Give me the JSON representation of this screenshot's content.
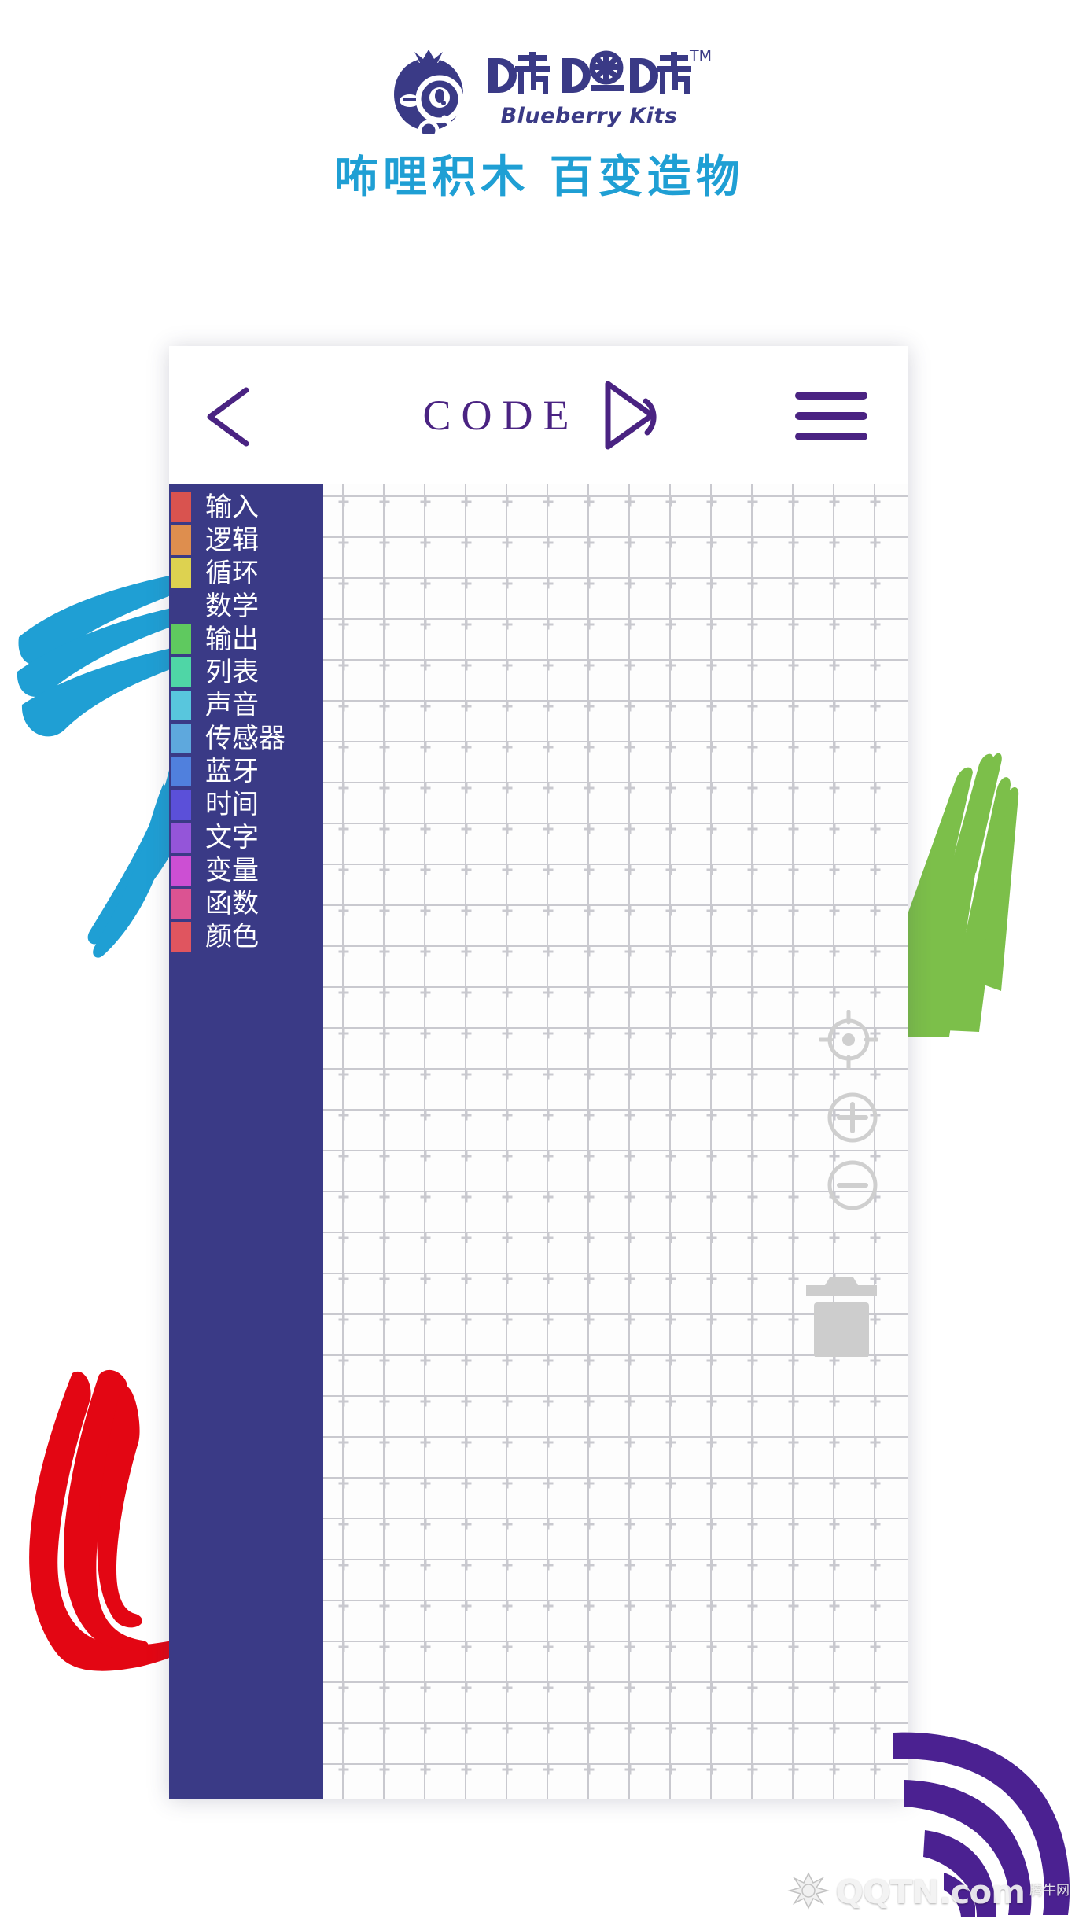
{
  "brand": {
    "logo_icon": "blueberry-character-icon",
    "wordmark": "咘哩咘哩",
    "subtitle": "Blueberry Kits",
    "trademark": "TM",
    "color": "#3a3a86"
  },
  "tagline": {
    "text": "咘哩积木  百变造物",
    "color": "#1f9fd4"
  },
  "app": {
    "header": {
      "back_icon": "chevron-left-icon",
      "title": "CODE",
      "play_icon": "play-triangle-icon",
      "menu_icon": "hamburger-menu-icon",
      "accent": "#4a2382"
    },
    "sidebar": {
      "background": "#3a3a86",
      "categories": [
        {
          "label": "输入",
          "color": "#d9534f"
        },
        {
          "label": "逻辑",
          "color": "#de8e4e"
        },
        {
          "label": "循环",
          "color": "#ddd250"
        },
        {
          "label": "数学",
          "color": "#a5d martini"
        },
        {
          "label": "输出",
          "color": "#5fc95f"
        },
        {
          "label": "列表",
          "color": "#4fd6a6"
        },
        {
          "label": "声音",
          "color": "#58c6dd"
        },
        {
          "label": "传感器",
          "color": "#5ea8dd"
        },
        {
          "label": "蓝牙",
          "color": "#5080dd"
        },
        {
          "label": "时间",
          "color": "#5b50d9"
        },
        {
          "label": "文字",
          "color": "#9455d9"
        },
        {
          "label": "变量",
          "color": "#cc4fd3"
        },
        {
          "label": "函数",
          "color": "#db5392"
        },
        {
          "label": "颜色",
          "color": "#e0555f"
        }
      ]
    },
    "canvas": {
      "grid_mark": "plus-cross-grid",
      "grid_color": "#c9c9cf",
      "background": "#fdfdfd",
      "controls": [
        {
          "name": "center-view-icon",
          "glyph": "crosshair"
        },
        {
          "name": "zoom-in-icon",
          "glyph": "+"
        },
        {
          "name": "zoom-out-icon",
          "glyph": "−"
        }
      ],
      "trash_icon": "trash-can-icon",
      "control_color": "#cfcfcf"
    }
  },
  "decorations": {
    "brushes": [
      {
        "name": "blue-brush-stroke",
        "color": "#1f9fd4"
      },
      {
        "name": "green-brush-stroke",
        "color": "#7cbf4a"
      },
      {
        "name": "red-brush-stroke",
        "color": "#e30613"
      },
      {
        "name": "purple-brush-stroke",
        "color": "#4b2191"
      }
    ]
  },
  "watermark": {
    "site": "QQTN.com",
    "cn": "腾牛网",
    "icon": "qqtn-logo-icon"
  }
}
